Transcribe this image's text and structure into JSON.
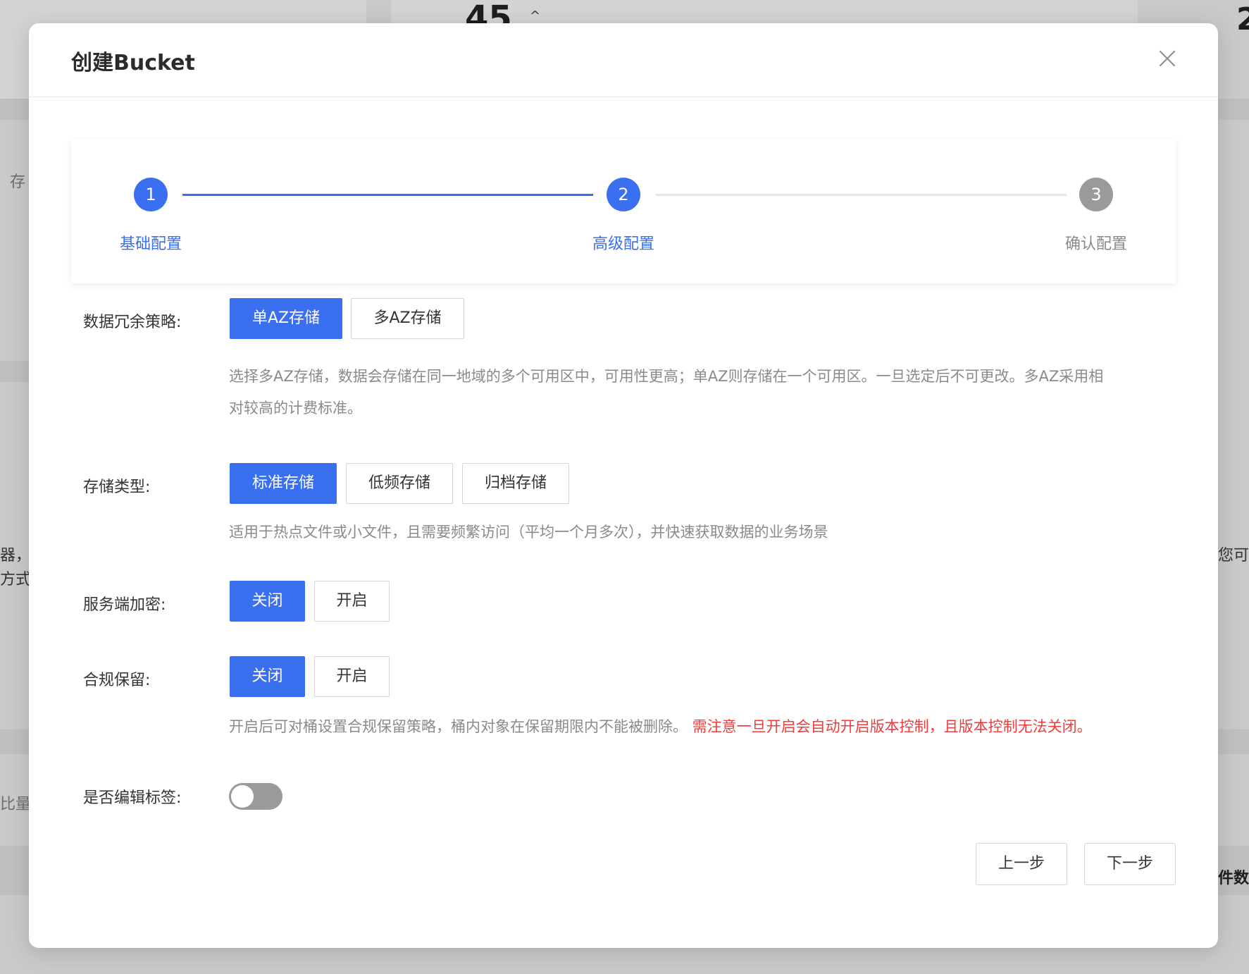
{
  "background": {
    "top_number": "45",
    "top_caret": "^",
    "right_top_number": "2",
    "left_fragments": [
      "存",
      "器，",
      "方式",
      "比量解"
    ],
    "right_fragments": [
      "您可以",
      "件数"
    ]
  },
  "modal": {
    "title": "创建Bucket",
    "close_icon": "close-icon"
  },
  "steps": [
    {
      "number": "1",
      "label": "基础配置",
      "state": "done"
    },
    {
      "number": "2",
      "label": "高级配置",
      "state": "active"
    },
    {
      "number": "3",
      "label": "确认配置",
      "state": "pending"
    }
  ],
  "form": {
    "redundancy": {
      "label": "数据冗余策略:",
      "options": [
        "单AZ存储",
        "多AZ存储"
      ],
      "selected": "单AZ存储",
      "hint_line1": "选择多AZ存储，数据会存储在同一地域的多个可用区中，可用性更高；单AZ则存储在一个可用区。一旦选定后不可更改。多AZ采用相",
      "hint_line2": "对较高的计费标准。"
    },
    "storage_type": {
      "label": "存储类型:",
      "options": [
        "标准存储",
        "低频存储",
        "归档存储"
      ],
      "selected": "标准存储",
      "hint": "适用于热点文件或小文件，且需要频繁访问（平均一个月多次），并快速获取数据的业务场景"
    },
    "encryption": {
      "label": "服务端加密:",
      "options": [
        "关闭",
        "开启"
      ],
      "selected": "关闭"
    },
    "compliance": {
      "label": "合规保留:",
      "options": [
        "关闭",
        "开启"
      ],
      "selected": "关闭",
      "hint": "开启后可对桶设置合规保留策略，桶内对象在保留期限内不能被删除。",
      "warning": "需注意一旦开启会自动开启版本控制，且版本控制无法关闭。"
    },
    "tags": {
      "label": "是否编辑标签:",
      "enabled": false
    }
  },
  "footer": {
    "prev": "上一步",
    "next": "下一步"
  },
  "colors": {
    "primary": "#3a6ff0",
    "warning": "#f03c3c",
    "pending": "#9a9a9c"
  }
}
